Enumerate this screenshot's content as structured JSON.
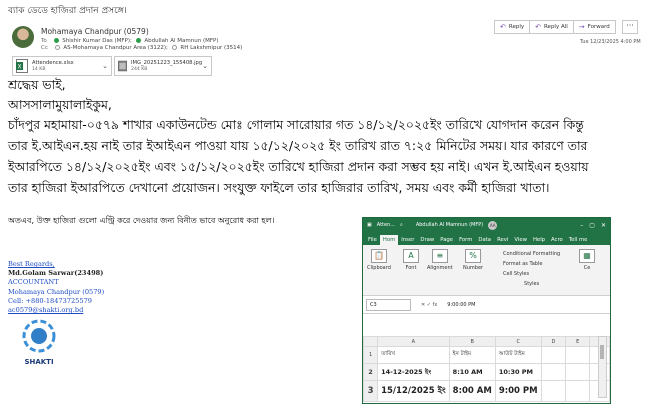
{
  "email": {
    "subject": "ব্যাক ডেডে হাজিরা প্রদান প্রসঙ্গে।",
    "sender": "Mohamaya Chandpur (0579)",
    "to_label": "To",
    "to": [
      "Shishir Kumar Das (MFP);",
      "Abdullah Al Mamnun (MFP)"
    ],
    "cc_label": "Cc",
    "cc": [
      "AS-Mohamaya Chandpur Area (3122);",
      "RH Lakshmipur (3514)"
    ],
    "timestamp": "Tue 12/23/2025 4:00 PM",
    "actions": {
      "reply": "Reply",
      "reply_all": "Reply All",
      "forward": "Forward",
      "more": "···"
    },
    "attachments": [
      {
        "name": "Attendence.xlsx",
        "size": "14 KB",
        "icon": "excel-file-icon"
      },
      {
        "name": "IMG_20251223_155408.jpg",
        "size": "244 KB",
        "icon": "image-file-icon"
      }
    ],
    "body": {
      "salutation": "শ্রদ্ধেয় ভাই,",
      "greeting": "আসসালামুয়ালাইকুম,",
      "paragraph_lines": [
        "চাঁদপুর মহামায়া-০৫৭৯ শাখার একাউনটেন্ড মোঃ গোলাম সারোয়ার গত ১৪/১২/২০২৫ইং তারিখে যোগদান করেন কিন্তু",
        "তার ই.আইএন.হয় নাই তার ইআইএন পাওয়া যায় ১৫/১২/২০২৫ ইং তারিখ রাত ৭:২৫ মিনিটের সময়। যার কারণে তার",
        "ইআরপিতে ১৪/১২/২০২৫ইং এবং ১৫/১২/২০২৫ইং তারিখে হাজিরা প্রদান করা সম্ভব হয় নাই। এখন ই.আইএন হওয়ায়",
        "তার হাজিরা ইআরপিতে দেখানো প্রয়োজন। সংযুক্ত ফাইলে তার হাজিরার তারিখ, সময় এবং কর্মী হাজিরা খাতা।"
      ],
      "closing_request": "অতএব, উক্ত হাজিরা গুলো এন্ট্রি করে দেওয়ার জন্য বিনীত ভাবে অনুরোধ করা হল।"
    },
    "signature": {
      "regards": "Best Regards,",
      "name": "Md.Golam Sarwar(23498)",
      "title": "ACCOUNTANT",
      "branch": "Mohamaya Chandpur (0579)",
      "cell": "Cell: +880-18473725579",
      "email": "ac0579@shakti.org.bd",
      "logo_text": "SHAKTI"
    }
  },
  "excel": {
    "title_left": "Atten...",
    "title_user": "Abdullah Al Mamnun (MFP)",
    "user_initials": "AA",
    "tabs": [
      "File",
      "Hom",
      "Inser",
      "Draw",
      "Page",
      "Form",
      "Data",
      "Revi",
      "View",
      "Help",
      "Acro",
      "Tell me"
    ],
    "ribbon": {
      "clipboard": "Clipboard",
      "font": "Font",
      "alignment": "Alignment",
      "number": "Number",
      "conditional_formatting": "Conditional Formatting",
      "format_as_table": "Format as Table",
      "cell_styles": "Cell Styles",
      "styles": "Styles",
      "cells": "Ce"
    },
    "name_box": "C3",
    "formula_value": "9:00:00 PM",
    "columns": [
      "A",
      "B",
      "C",
      "D",
      "E",
      "F"
    ],
    "rows": [
      {
        "num": "1",
        "cells": [
          "তারিখ",
          "ইন টাইম",
          "আউট টাইম",
          "",
          "",
          ""
        ]
      },
      {
        "num": "2",
        "cells": [
          "14-12-2025 ইং",
          "8:10 AM",
          "10:30 PM",
          "",
          "",
          ""
        ]
      },
      {
        "num": "3",
        "cells": [
          "15/12/2025 ইং",
          "8:00 AM",
          "9:00 PM",
          "",
          "",
          ""
        ]
      }
    ]
  }
}
